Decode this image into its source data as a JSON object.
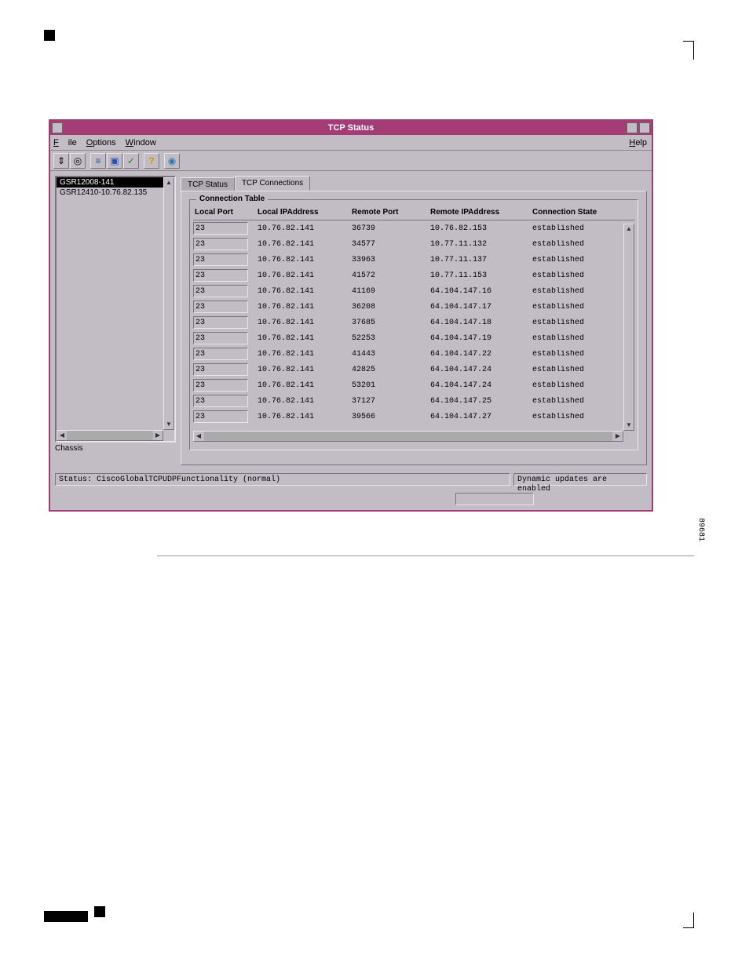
{
  "window": {
    "title": "TCP Status"
  },
  "menu": {
    "file": "File",
    "options": "Options",
    "window": "Window",
    "help": "Help"
  },
  "toolbar": {
    "icon1": "⇕",
    "icon2": "◎",
    "icon3": "≡",
    "icon4": "▣",
    "icon5": "✓",
    "icon6": "?",
    "icon7": "◉"
  },
  "tree": {
    "items": [
      {
        "label": "GSR12008-141",
        "selected": true
      },
      {
        "label": "GSR12410-10.76.82.135",
        "selected": false
      }
    ],
    "bottom_label": "Chassis"
  },
  "tabs": {
    "tab1": "TCP Status",
    "tab2": "TCP Connections",
    "group_title": "Connection Table"
  },
  "table": {
    "headers": {
      "local_port": "Local Port",
      "local_ip": "Local IPAddress",
      "remote_port": "Remote Port",
      "remote_ip": "Remote IPAddress",
      "conn_state": "Connection State"
    },
    "rows": [
      {
        "lport": "23",
        "laddr": "10.76.82.141",
        "rport": "36739",
        "raddr": "10.76.82.153",
        "state": "established"
      },
      {
        "lport": "23",
        "laddr": "10.76.82.141",
        "rport": "34577",
        "raddr": "10.77.11.132",
        "state": "established"
      },
      {
        "lport": "23",
        "laddr": "10.76.82.141",
        "rport": "33963",
        "raddr": "10.77.11.137",
        "state": "established"
      },
      {
        "lport": "23",
        "laddr": "10.76.82.141",
        "rport": "41572",
        "raddr": "10.77.11.153",
        "state": "established"
      },
      {
        "lport": "23",
        "laddr": "10.76.82.141",
        "rport": "41169",
        "raddr": "64.104.147.16",
        "state": "established"
      },
      {
        "lport": "23",
        "laddr": "10.76.82.141",
        "rport": "36208",
        "raddr": "64.104.147.17",
        "state": "established"
      },
      {
        "lport": "23",
        "laddr": "10.76.82.141",
        "rport": "37685",
        "raddr": "64.104.147.18",
        "state": "established"
      },
      {
        "lport": "23",
        "laddr": "10.76.82.141",
        "rport": "52253",
        "raddr": "64.104.147.19",
        "state": "established"
      },
      {
        "lport": "23",
        "laddr": "10.76.82.141",
        "rport": "41443",
        "raddr": "64.104.147.22",
        "state": "established"
      },
      {
        "lport": "23",
        "laddr": "10.76.82.141",
        "rport": "42825",
        "raddr": "64.104.147.24",
        "state": "established"
      },
      {
        "lport": "23",
        "laddr": "10.76.82.141",
        "rport": "53201",
        "raddr": "64.104.147.24",
        "state": "established"
      },
      {
        "lport": "23",
        "laddr": "10.76.82.141",
        "rport": "37127",
        "raddr": "64.104.147.25",
        "state": "established"
      },
      {
        "lport": "23",
        "laddr": "10.76.82.141",
        "rport": "39566",
        "raddr": "64.104.147.27",
        "state": "established"
      }
    ]
  },
  "status": {
    "main": "Status: CiscoGlobalTCPUDPFunctionality (normal)",
    "dynamic": "Dynamic updates are enabled"
  },
  "side_id": "89681"
}
